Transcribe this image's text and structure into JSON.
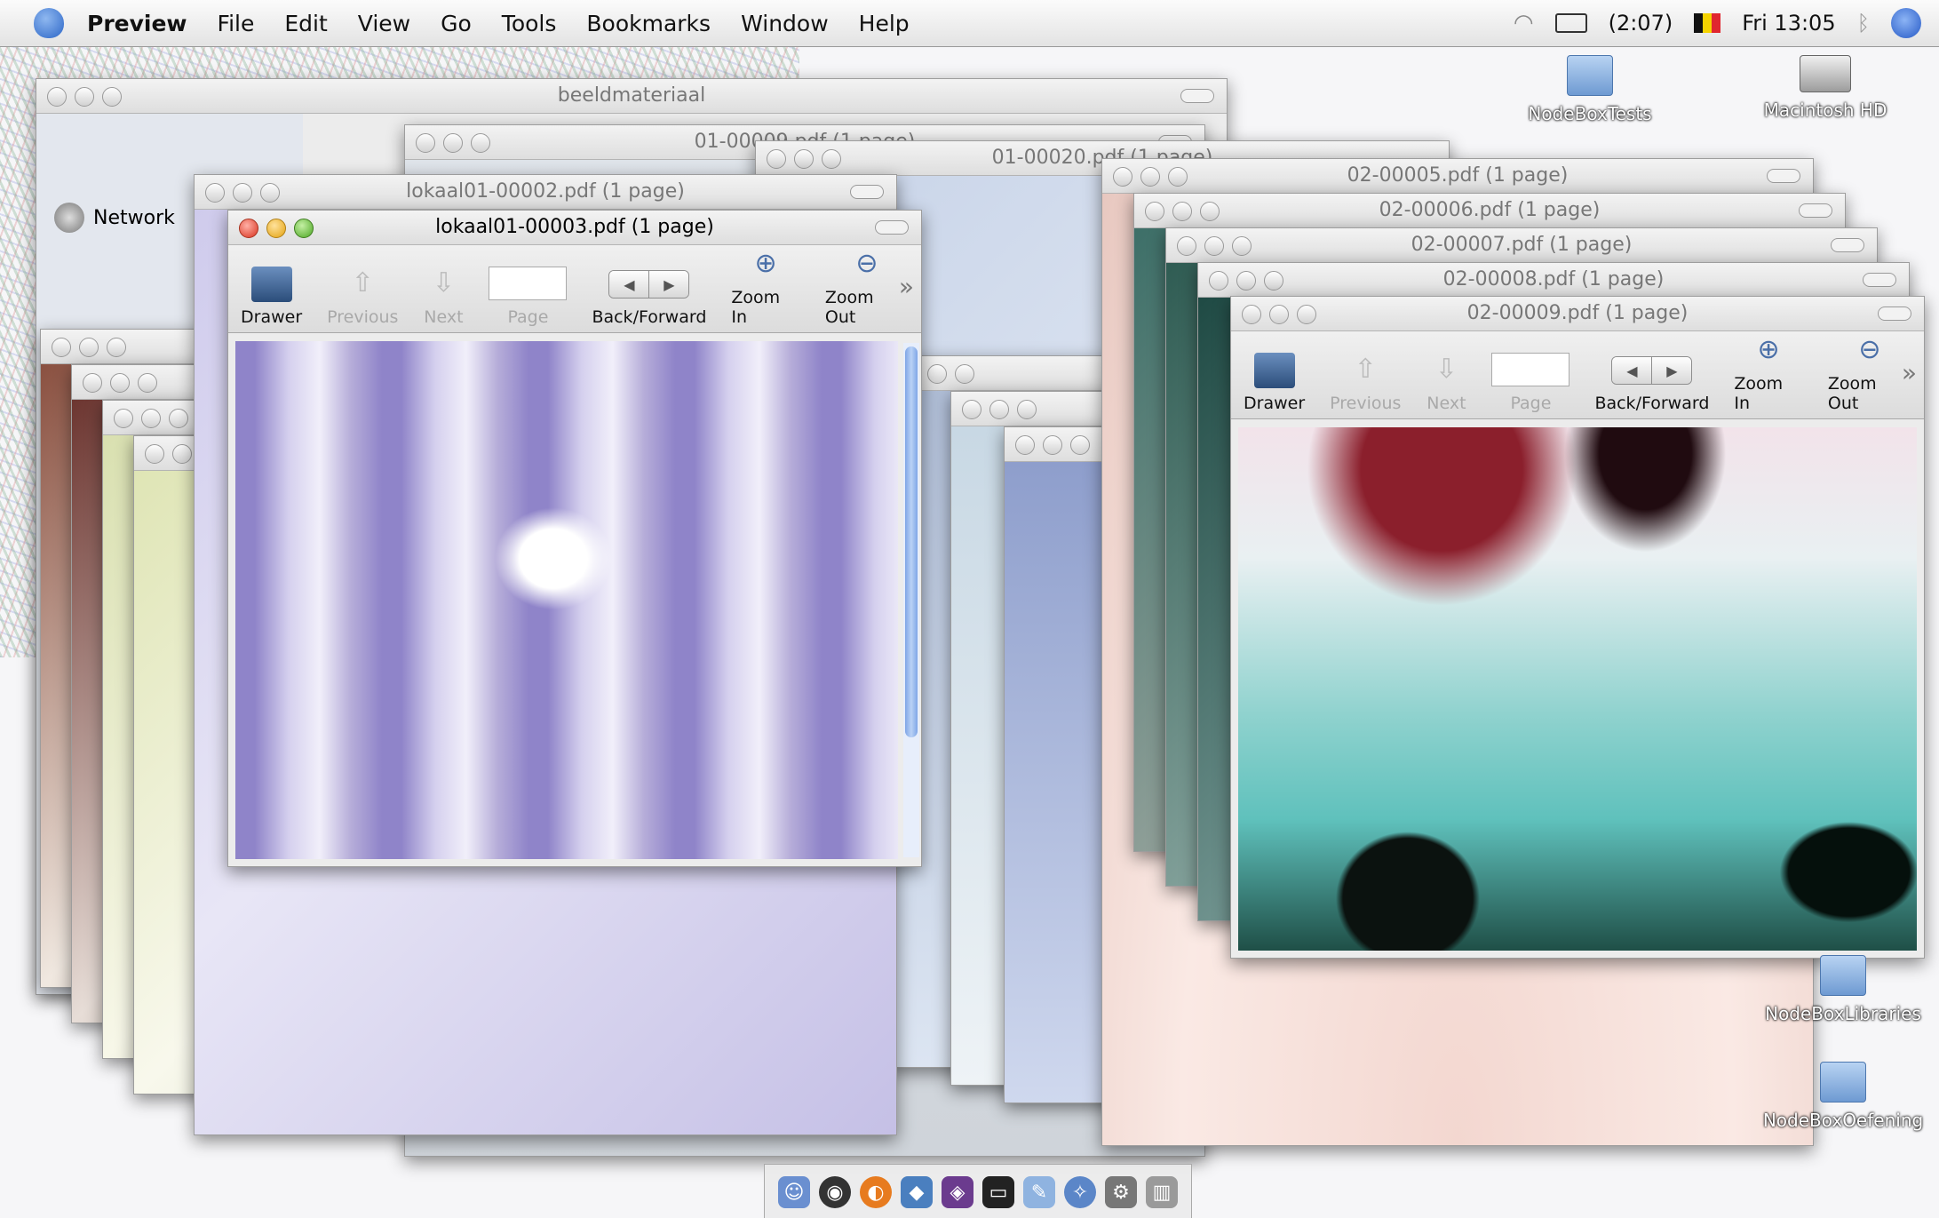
{
  "menubar": {
    "app": "Preview",
    "items": [
      "File",
      "Edit",
      "View",
      "Go",
      "Tools",
      "Bookmarks",
      "Window",
      "Help"
    ],
    "battery": "(2:07)",
    "clock": "Fri 13:05"
  },
  "finder": {
    "title": "beeldmateriaal",
    "sidebar": [
      "Network"
    ]
  },
  "toolbar": {
    "drawer": "Drawer",
    "previous": "Previous",
    "next": "Next",
    "page": "Page",
    "back_forward": "Back/Forward",
    "zoom_in": "Zoom In",
    "zoom_out": "Zoom Out",
    "more": "»"
  },
  "windows": {
    "w_01_00009": "01-00009.pdf (1 page)",
    "w_01_00020": "01-00020.pdf (1 page)",
    "w_lokaal_00002": "lokaal01-00002.pdf (1 page)",
    "w_lokaal_00003": "lokaal01-00003.pdf (1 page)",
    "w_02_00005": "02-00005.pdf (1 page)",
    "w_02_00006": "02-00006.pdf (1 page)",
    "w_02_00007": "02-00007.pdf (1 page)",
    "w_02_00008": "02-00008.pdf (1 page)",
    "w_02_00009": "02-00009.pdf (1 page)"
  },
  "desktop": {
    "icons": [
      "NodeBoxTests",
      "Macintosh HD",
      "NodeBoxLibraries",
      "NodeBoxOefening"
    ]
  },
  "icons": {
    "apple": "apple-icon",
    "wifi": "wifi-icon",
    "battery": "battery-icon",
    "flag": "belgium-flag-icon",
    "bluetooth": "bluetooth-icon",
    "spotlight": "spotlight-icon"
  },
  "colors": {
    "purple_doc": "#b9b0e0",
    "teal_doc": "#6fc8c4"
  }
}
